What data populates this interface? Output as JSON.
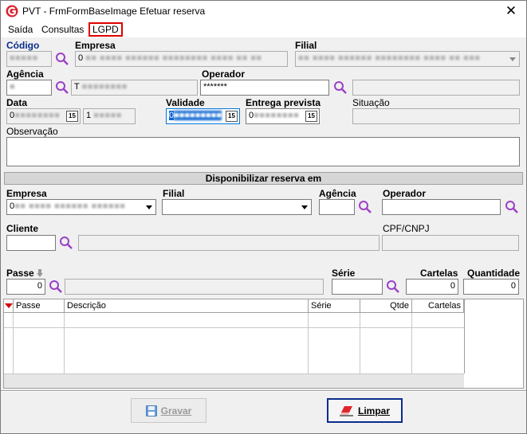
{
  "window": {
    "title": "PVT - FrmFormBaseImage Efetuar reserva",
    "close": "✕"
  },
  "menu": {
    "items": [
      "Saída",
      "Consultas",
      "LGPD"
    ]
  },
  "top": {
    "codigo_label": "Código",
    "empresa_label": "Empresa",
    "empresa_value": "0",
    "filial_label": "Filial",
    "agencia_label": "Agência",
    "agencia_value2": "T",
    "operador_label": "Operador",
    "operador_value": "*******",
    "data_label": "Data",
    "data_value": "0",
    "data_time": "1",
    "validade_label": "Validade",
    "validade_value": "0",
    "entrega_label": "Entrega prevista",
    "entrega_value": "0",
    "situacao_label": "Situação",
    "observacao_label": "Observação",
    "cal_glyph": "15"
  },
  "section": {
    "title": "Disponibilizar reserva em"
  },
  "bottom": {
    "empresa_label": "Empresa",
    "empresa_value": "0",
    "filial_label": "Filial",
    "agencia_label": "Agência",
    "operador_label": "Operador",
    "cliente_label": "Cliente",
    "cpf_label": "CPF/CNPJ",
    "passe_label": "Passe",
    "passe_value": "0",
    "serie_label": "Série",
    "cartelas_label": "Cartelas",
    "cartelas_value": "0",
    "quantidade_label": "Quantidade",
    "quantidade_value": "0"
  },
  "grid": {
    "columns": [
      "Passe",
      "Descrição",
      "Série",
      "Qtde",
      "Cartelas"
    ]
  },
  "buttons": {
    "gravar": "Gravar",
    "limpar": "Limpar"
  },
  "colors": {
    "accent_blue": "#0a2d8c",
    "lens_purple": "#9b3fc7",
    "menu_highlight": "#e00000"
  }
}
